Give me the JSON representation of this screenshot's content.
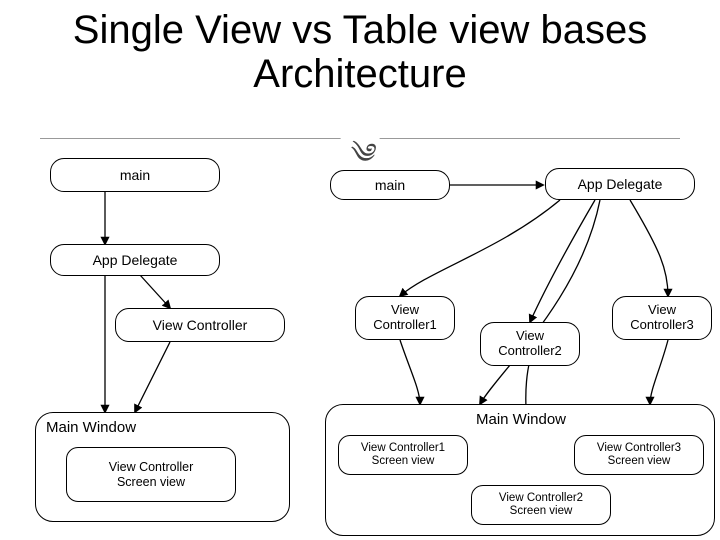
{
  "title": "Single View vs Table view bases Architecture",
  "flourish": "",
  "left": {
    "main": "main",
    "app_delegate": "App Delegate",
    "view_controller": "View Controller",
    "main_window": "Main Window",
    "vc_screen": "View Controller\nScreen view"
  },
  "right": {
    "main": "main",
    "app_delegate": "App Delegate",
    "vc1": "View\nController1",
    "vc2": "View\nController2",
    "vc3": "View\nController3",
    "main_window": "Main Window",
    "vc1_screen": "View Controller1\nScreen view",
    "vc2_screen": "View Controller2\nScreen view",
    "vc3_screen": "View Controller3\nScreen view"
  }
}
